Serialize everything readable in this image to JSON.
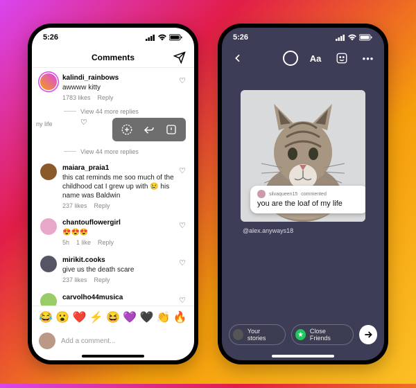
{
  "status": {
    "time": "5:26"
  },
  "left": {
    "header_title": "Comments",
    "snippet": "ny life",
    "view_more": "View 44 more replies",
    "comments": [
      {
        "user": "kalindi_rainbows",
        "text": "awwww kitty",
        "likes": "1783 likes",
        "reply": "Reply"
      },
      {
        "user": "maiara_praia1",
        "text": "this cat reminds me soo much of the childhood cat I grew up with 😢 his name was Baldwin",
        "likes": "237 likes",
        "reply": "Reply"
      },
      {
        "user": "chantouflowergirl",
        "text": "😍😍😍",
        "likes": "1 like",
        "time": "5h",
        "reply": "Reply"
      },
      {
        "user": "mirikit.cooks",
        "text": "give us the death scare",
        "likes": "237 likes",
        "reply": "Reply"
      },
      {
        "user": "carvolho44musica",
        "text": "",
        "likes": "",
        "reply": ""
      }
    ],
    "emoji_row": [
      "😂",
      "😮",
      "❤️",
      "⚡",
      "😆",
      "💜",
      "🖤",
      "👏",
      "🔥"
    ],
    "composer_placeholder": "Add a comment..."
  },
  "right": {
    "tool_text_label": "Aa",
    "overlay": {
      "user": "silvaqueen15",
      "action": "commented",
      "msg": "you are the loaf of my life"
    },
    "mention": "@alex.anyways18",
    "chips": {
      "your_stories": "Your stories",
      "close_friends": "Close Friends"
    }
  }
}
